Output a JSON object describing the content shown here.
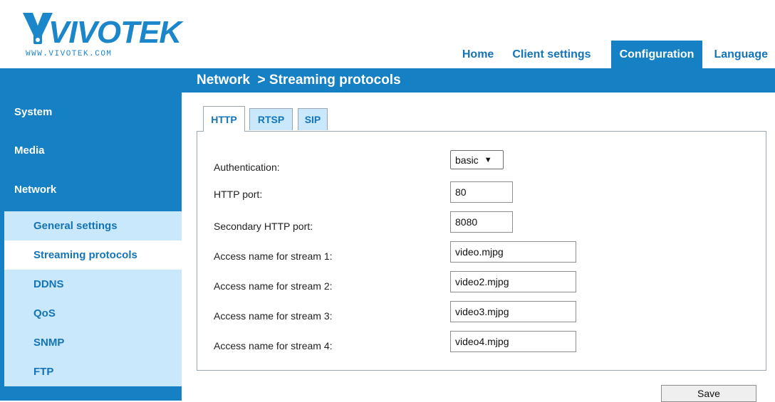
{
  "brand": {
    "name": "VIVOTEK",
    "url": "WWW.VIVOTEK.COM",
    "color": "#1b86c9"
  },
  "topnav": [
    "Home",
    "Client settings",
    "Configuration",
    "Language"
  ],
  "page_title": "Network  > Streaming protocols",
  "sidebar": {
    "main": [
      "System",
      "Media",
      "Network"
    ],
    "sub": [
      "General settings",
      "Streaming protocols",
      "DDNS",
      "QoS",
      "SNMP",
      "FTP"
    ],
    "selected": "Streaming protocols"
  },
  "tabs": [
    "HTTP",
    "RTSP",
    "SIP"
  ],
  "form": {
    "authentication_label": "Authentication:",
    "authentication_value": "basic",
    "http_port_label": "HTTP port:",
    "http_port_value": "80",
    "secondary_port_label": "Secondary HTTP port:",
    "secondary_port_value": "8080",
    "stream1_label": "Access name for stream 1:",
    "stream1_value": "video.mjpg",
    "stream2_label": "Access name for stream 2:",
    "stream2_value": "video2.mjpg",
    "stream3_label": "Access name for stream 3:",
    "stream3_value": "video3.mjpg",
    "stream4_label": "Access name for stream 4:",
    "stream4_value": "video4.mjpg"
  },
  "save_label": "Save",
  "colors": {
    "primary": "#1581c4",
    "link": "#1474b9",
    "sub_bg": "#c9e8fb"
  }
}
